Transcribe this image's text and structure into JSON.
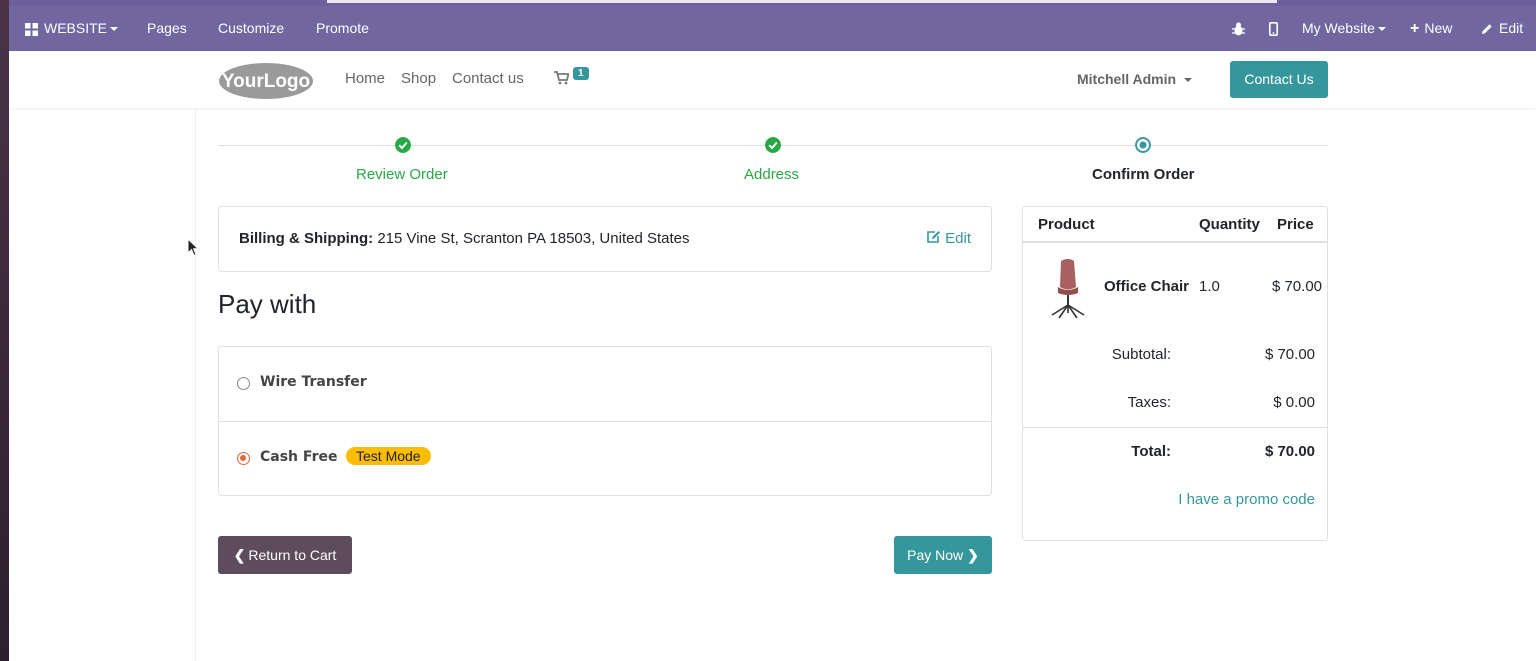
{
  "adminbar": {
    "website_menu": "WEBSITE",
    "pages": "Pages",
    "customize": "Customize",
    "promote": "Promote",
    "my_website": "My Website",
    "new": "New",
    "edit": "Edit"
  },
  "header": {
    "logo_text": "YourLogo",
    "nav": [
      "Home",
      "Shop",
      "Contact us"
    ],
    "cart_count": "1",
    "user": "Mitchell Admin",
    "contact_button": "Contact Us"
  },
  "steps": [
    {
      "label": "Review Order",
      "state": "done"
    },
    {
      "label": "Address",
      "state": "done"
    },
    {
      "label": "Confirm Order",
      "state": "current"
    }
  ],
  "billing": {
    "label": "Billing & Shipping:",
    "address": "215 Vine St, Scranton PA 18503, United States",
    "edit": "Edit"
  },
  "pay_with": {
    "title": "Pay with",
    "methods": [
      {
        "name": "Wire Transfer",
        "selected": false
      },
      {
        "name": "Cash Free",
        "selected": true,
        "badge": "Test Mode"
      }
    ]
  },
  "buttons": {
    "return": "Return to Cart",
    "pay": "Pay Now"
  },
  "summary": {
    "headers": {
      "product": "Product",
      "quantity": "Quantity",
      "price": "Price"
    },
    "item": {
      "name": "Office Chair",
      "quantity": "1.0",
      "price": "$ 70.00"
    },
    "subtotal_label": "Subtotal:",
    "subtotal": "$ 70.00",
    "taxes_label": "Taxes:",
    "taxes": "$ 0.00",
    "total_label": "Total:",
    "total": "$ 70.00",
    "promo": "I have a promo code"
  },
  "colors": {
    "adminbar": "#7166a0",
    "teal": "#35979c",
    "success": "#28a745",
    "return_btn": "#5e4c5d",
    "badge": "#fbbc05"
  }
}
